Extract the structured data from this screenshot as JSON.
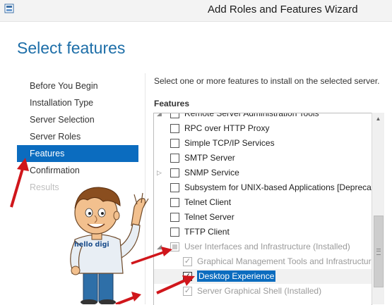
{
  "window": {
    "title": "Add Roles and Features Wizard"
  },
  "page_title": "Select features",
  "steps": [
    {
      "label": "Before You Begin",
      "state": "normal"
    },
    {
      "label": "Installation Type",
      "state": "normal"
    },
    {
      "label": "Server Selection",
      "state": "normal"
    },
    {
      "label": "Server Roles",
      "state": "normal"
    },
    {
      "label": "Features",
      "state": "active"
    },
    {
      "label": "Confirmation",
      "state": "normal"
    },
    {
      "label": "Results",
      "state": "disabled"
    }
  ],
  "instruction": "Select one or more features to install on the selected server.",
  "features_label": "Features",
  "features": [
    {
      "label": "Remote Server Administration Tools"
    },
    {
      "label": "RPC over HTTP Proxy"
    },
    {
      "label": "Simple TCP/IP Services"
    },
    {
      "label": "SMTP Server"
    },
    {
      "label": "SNMP Service"
    },
    {
      "label": "Subsystem for UNIX-based Applications [Deprecated]"
    },
    {
      "label": "Telnet Client"
    },
    {
      "label": "Telnet Server"
    },
    {
      "label": "TFTP Client"
    },
    {
      "label": "User Interfaces and Infrastructure (Installed)"
    },
    {
      "label": "Graphical Management Tools and Infrastructure"
    },
    {
      "label": "Desktop Experience"
    },
    {
      "label": "Server Graphical Shell (Installed)"
    }
  ],
  "mascot": {
    "shirt_text": "hello digi"
  },
  "colors": {
    "accent": "#0b6cbf",
    "title_blue": "#1d6ea8",
    "arrow_red": "#d0161b"
  }
}
